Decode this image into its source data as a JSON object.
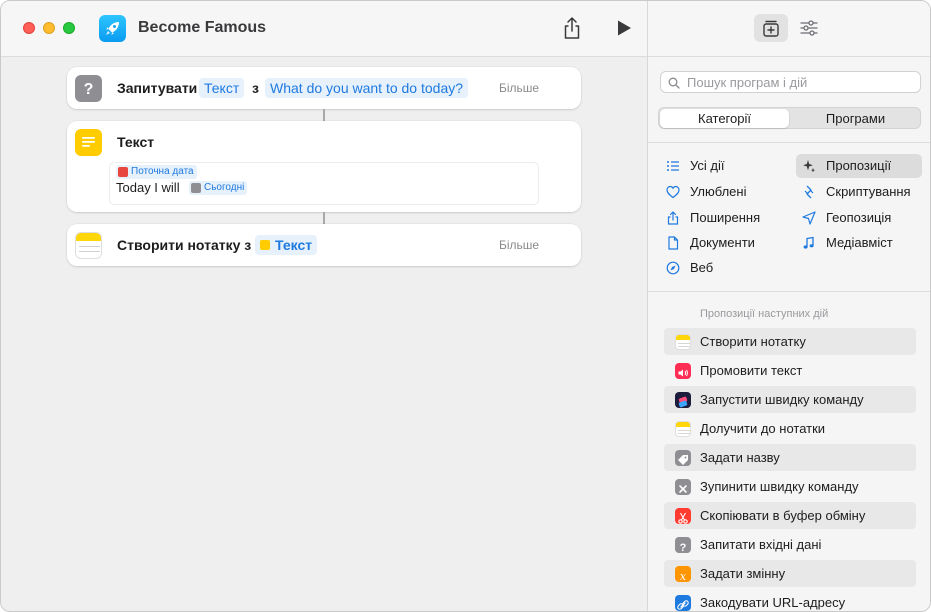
{
  "window": {
    "title": "Become Famous"
  },
  "actions": [
    {
      "label": "Запитувати",
      "token_type": "Текст",
      "connector": "з",
      "token_prompt": "What do you want to do today?",
      "more": "Більше"
    },
    {
      "label": "Текст",
      "date_token": "Поточна дата",
      "body_text": "Today I will",
      "today_token": "Сьогодні"
    },
    {
      "label": "Створити нотатку з",
      "token": "Текст",
      "more": "Більше"
    }
  ],
  "sidebar": {
    "search_placeholder": "Пошук програм і дій",
    "segments": [
      "Категорії",
      "Програми"
    ],
    "categories_left": [
      "Усі дії",
      "Улюблені",
      "Поширення",
      "Документи",
      "Веб"
    ],
    "categories_right": [
      "Пропозиції",
      "Скриптування",
      "Геопозиція",
      "Медіавміст"
    ],
    "suggestions_title": "Пропозиції наступних дій",
    "suggestions": [
      "Створити нотатку",
      "Промовити текст",
      "Запустити швидку команду",
      "Долучити до нотатки",
      "Задати назву",
      "Зупинити швидку команду",
      "Скопіювати в буфер обміну",
      "Запитати вхідні дані",
      "Задати змінну",
      "Закодувати URL-адресу"
    ]
  },
  "colors": {
    "accent": "#1f7ae0",
    "notes_yellow": "#ffd60a",
    "app_icon_blue": "#0a9bf0"
  }
}
